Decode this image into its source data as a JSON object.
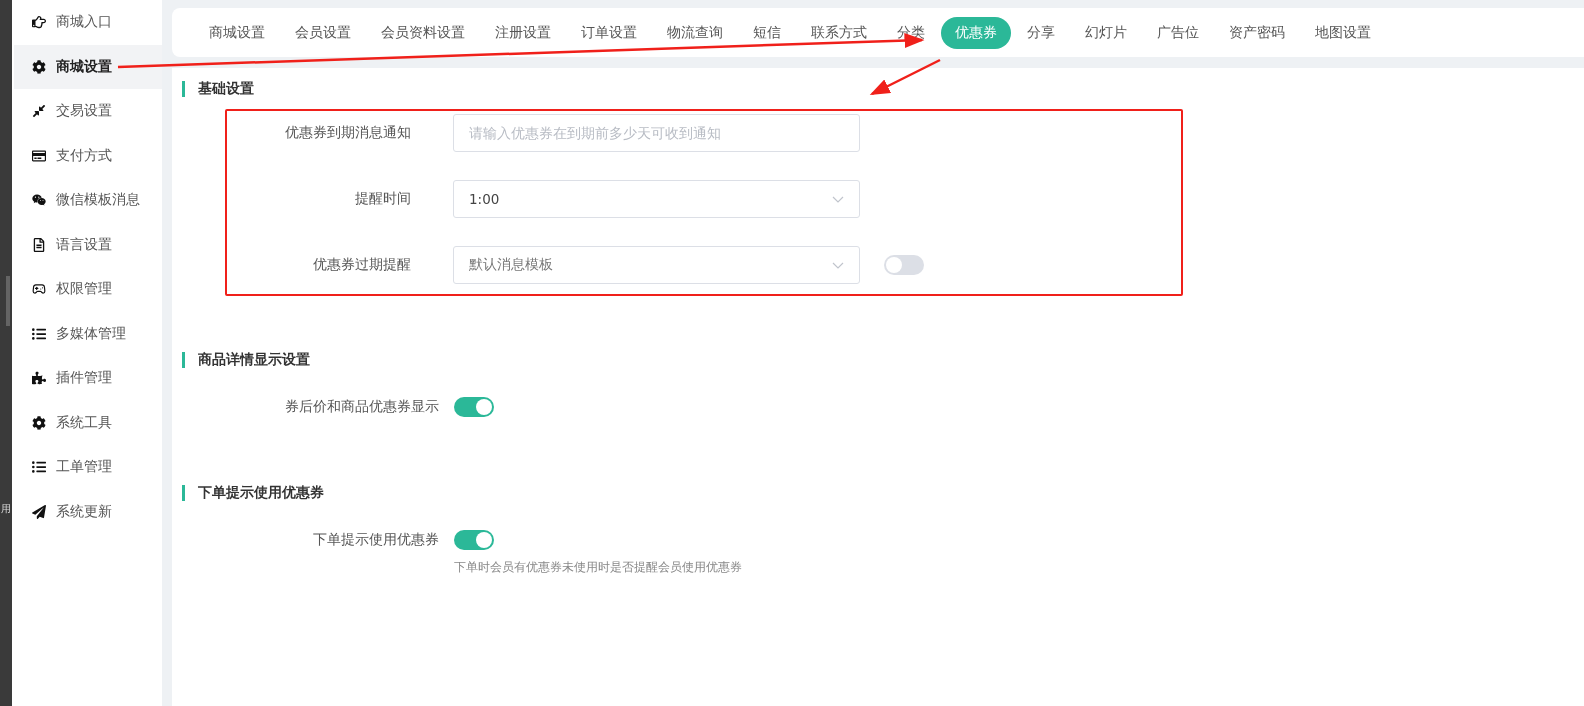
{
  "edge_strip": {
    "text": "用"
  },
  "sidebar": {
    "items": [
      {
        "label": "商城入口",
        "selected": false
      },
      {
        "label": "商城设置",
        "selected": true
      },
      {
        "label": "交易设置",
        "selected": false
      },
      {
        "label": "支付方式",
        "selected": false
      },
      {
        "label": "微信模板消息",
        "selected": false
      },
      {
        "label": "语言设置",
        "selected": false
      },
      {
        "label": "权限管理",
        "selected": false
      },
      {
        "label": "多媒体管理",
        "selected": false
      },
      {
        "label": "插件管理",
        "selected": false
      },
      {
        "label": "系统工具",
        "selected": false
      },
      {
        "label": "工单管理",
        "selected": false
      },
      {
        "label": "系统更新",
        "selected": false
      }
    ]
  },
  "tabs": [
    {
      "label": "商城设置",
      "selected": false
    },
    {
      "label": "会员设置",
      "selected": false
    },
    {
      "label": "会员资料设置",
      "selected": false
    },
    {
      "label": "注册设置",
      "selected": false
    },
    {
      "label": "订单设置",
      "selected": false
    },
    {
      "label": "物流查询",
      "selected": false
    },
    {
      "label": "短信",
      "selected": false
    },
    {
      "label": "联系方式",
      "selected": false
    },
    {
      "label": "分类",
      "selected": false
    },
    {
      "label": "优惠券",
      "selected": true
    },
    {
      "label": "分享",
      "selected": false
    },
    {
      "label": "幻灯片",
      "selected": false
    },
    {
      "label": "广告位",
      "selected": false
    },
    {
      "label": "资产密码",
      "selected": false
    },
    {
      "label": "地图设置",
      "selected": false
    }
  ],
  "sections": [
    {
      "title": "基础设置",
      "annotated": true,
      "fields": [
        {
          "kind": "input",
          "label": "优惠券到期消息通知",
          "placeholder": "请输入优惠券在到期前多少天可收到通知"
        },
        {
          "kind": "select",
          "label": "提醒时间",
          "value": "1:00"
        },
        {
          "kind": "select_switch",
          "label": "优惠券过期提醒",
          "placeholder": "默认消息模板",
          "on": false
        }
      ]
    },
    {
      "title": "商品详情显示设置",
      "annotated": false,
      "fields": [
        {
          "kind": "switch",
          "label": "券后价和商品优惠券显示",
          "on": true
        }
      ]
    },
    {
      "title": "下单提示使用优惠券",
      "annotated": false,
      "fields": [
        {
          "kind": "switch",
          "label": "下单提示使用优惠券",
          "on": true,
          "hint": "下单时会员有优惠券未使用时是否提醒会员使用优惠券"
        }
      ]
    }
  ]
}
